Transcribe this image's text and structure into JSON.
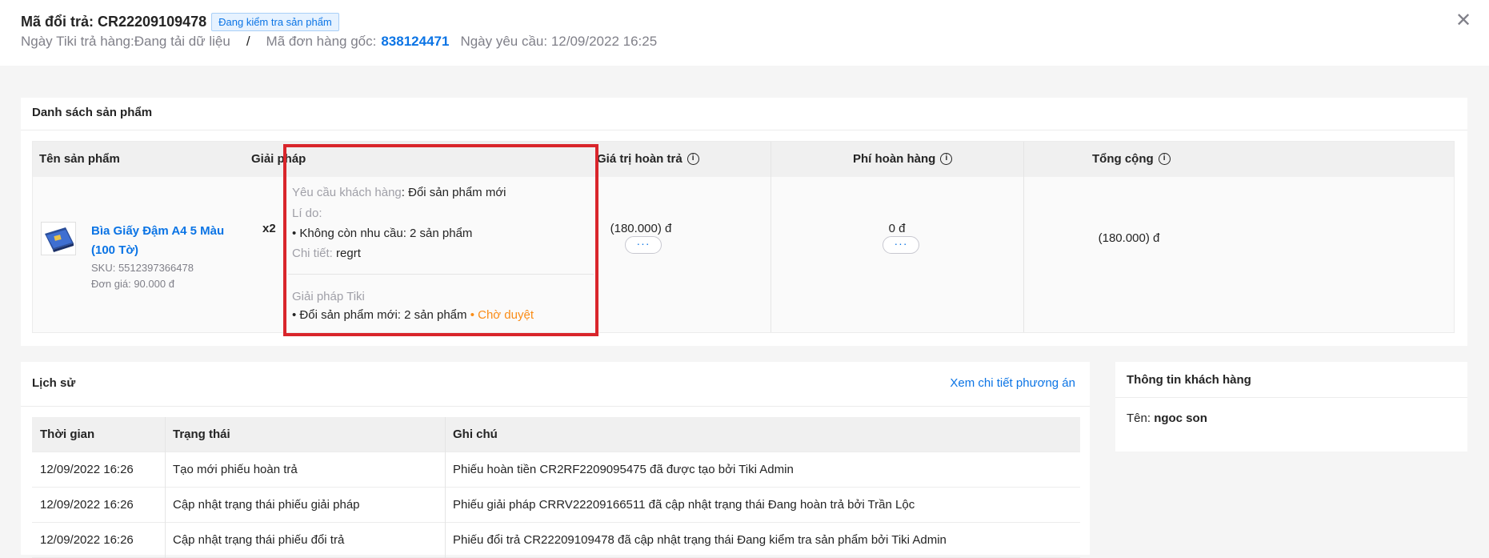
{
  "header": {
    "title": "Mã đổi trả: CR22209109478",
    "status_badge": "Đang kiểm tra sản phẩm",
    "return_date_label": "Ngày Tiki trả hàng:",
    "return_date_value": "Đang tải dữ liệu",
    "separator": "/",
    "order_label": "Mã đơn hàng gốc:",
    "order_value": "838124471",
    "request_date": "Ngày yêu cầu: 12/09/2022 16:25",
    "close_icon": "close-icon"
  },
  "products": {
    "title": "Danh sách sản phẩm",
    "columns": {
      "name": "Tên sản phẩm",
      "solution": "Giải pháp",
      "refund_value": "Giá trị hoàn trả",
      "return_fee": "Phí hoàn hàng",
      "total": "Tổng cộng"
    },
    "item": {
      "name": "Bìa Giấy Đậm A4 5 Màu (100 Tờ)",
      "qty": "x2",
      "sku": "SKU: 5512397366478",
      "unit_price": "Đơn giá: 90.000 đ",
      "request_label": "Yêu cầu khách hàng",
      "request_value": ": Đổi sản phẩm mới",
      "reason_label": "Lí do:",
      "reason_value": "• Không còn nhu cầu: 2 sản phẩm",
      "detail_label": "Chi tiết:",
      "detail_value": "regrt",
      "tiki_solution_label": "Giải pháp Tiki",
      "tiki_solution_value": "• Đổi sản phẩm mới: 2 sản phẩm",
      "tiki_solution_status": "• Chờ duyệt",
      "refund_value": "(180.000) đ",
      "return_fee": "0 đ",
      "total": "(180.000) đ",
      "more": "···"
    }
  },
  "history": {
    "title": "Lịch sử",
    "link": "Xem chi tiết phương án",
    "columns": [
      "Thời gian",
      "Trạng thái",
      "Ghi chú"
    ],
    "rows": [
      [
        "12/09/2022 16:26",
        "Tạo mới phiếu hoàn trả",
        "Phiếu hoàn tiền CR2RF2209095475 đã được tạo bởi Tiki Admin"
      ],
      [
        "12/09/2022 16:26",
        "Cập nhật trạng thái phiếu giải pháp",
        "Phiếu giải pháp CRRV22209166511 đã cập nhật trạng thái Đang hoàn trả bởi Trần Lộc"
      ],
      [
        "12/09/2022 16:26",
        "Cập nhật trạng thái phiếu đổi trả",
        "Phiếu đổi trả CR22209109478 đã cập nhật trạng thái Đang kiểm tra sản phẩm bởi Tiki Admin"
      ]
    ]
  },
  "customer": {
    "title": "Thông tin khách hàng",
    "name_label": "Tên:",
    "name_value": "ngoc son"
  },
  "colors": {
    "accent": "#0b74e5",
    "highlight_border": "#d9252b",
    "money": "#fa8c16"
  }
}
